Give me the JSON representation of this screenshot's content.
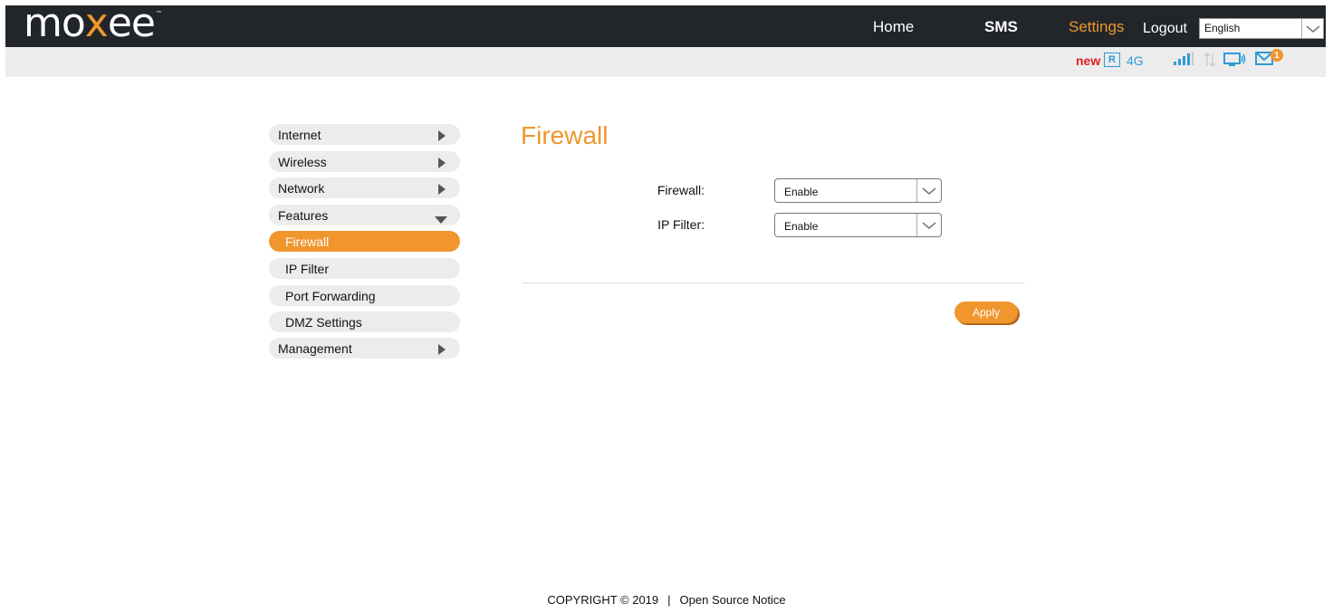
{
  "header": {
    "logo": {
      "part1": "mo",
      "part2": "x",
      "part3": "ee",
      "tm": "™"
    },
    "nav": {
      "home": "Home",
      "sms": "SMS",
      "settings": "Settings",
      "logout": "Logout"
    },
    "language": {
      "selected": "English"
    }
  },
  "status": {
    "new_label": "new",
    "roaming": "R",
    "network_type": "4G",
    "message_count": "1",
    "icons": [
      "roaming-icon",
      "signal-icon",
      "traffic-icon",
      "device-icon",
      "mail-icon"
    ]
  },
  "sidebar": {
    "items": [
      {
        "label": "Internet"
      },
      {
        "label": "Wireless"
      },
      {
        "label": "Network"
      },
      {
        "label": "Features"
      },
      {
        "label": "Firewall"
      },
      {
        "label": "IP Filter"
      },
      {
        "label": "Port Forwarding"
      },
      {
        "label": "DMZ Settings"
      },
      {
        "label": "Management"
      }
    ],
    "active": "Firewall"
  },
  "main": {
    "title": "Firewall",
    "firewall_label": "Firewall:",
    "firewall_value": "Enable",
    "ip_filter_label": "IP Filter:",
    "ip_filter_value": "Enable",
    "apply_label": "Apply"
  },
  "footer": {
    "copyright": "COPYRIGHT © 2019",
    "separator": "|",
    "link": "Open Source Notice"
  },
  "colors": {
    "accent": "#f0962d",
    "topbar": "#22262a",
    "status_blue": "#2f9ad8",
    "new_red": "#e02020"
  }
}
